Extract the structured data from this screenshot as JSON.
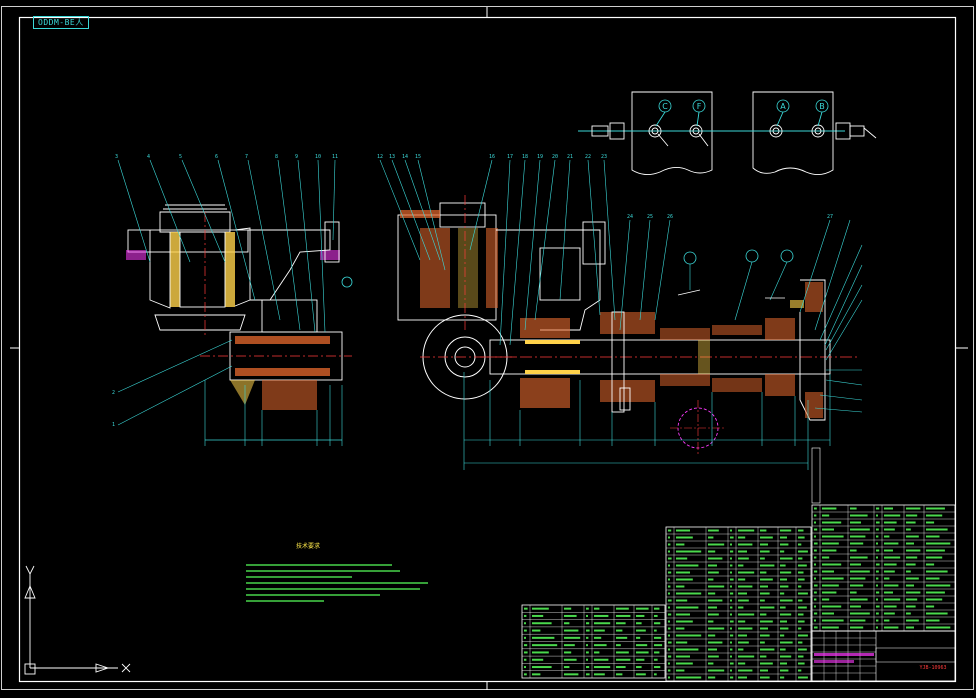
{
  "sheet": {
    "tag_label": "ODDM-BE人",
    "notes_title": "技术要求",
    "title_block_name": "",
    "drawing_number": "YJB-10963"
  },
  "section_labels": [
    "C",
    "F",
    "A",
    "B"
  ],
  "callouts_left": [
    "1",
    "2",
    "3",
    "4",
    "5",
    "6",
    "7",
    "8",
    "9",
    "10",
    "11"
  ],
  "callouts_middle": [
    "12",
    "13",
    "14",
    "15",
    "16",
    "17",
    "18",
    "19",
    "20",
    "21",
    "22",
    "23",
    "24",
    "25",
    "26",
    "27"
  ],
  "colors": {
    "frame": "#ffffff",
    "outline": "#ffffff",
    "section_line": "#3bd9d9",
    "dimension": "#3bd9d9",
    "hatch": "#e86a2e",
    "hatch_alt": "#ffd24a",
    "center_line": "#ff3b3b",
    "notes_text": "#57ff5a",
    "table_line": "#ffffff",
    "table_text": "#57ff5a",
    "highlight": "#ff3bff",
    "callout_text": "#3bd9d9"
  }
}
